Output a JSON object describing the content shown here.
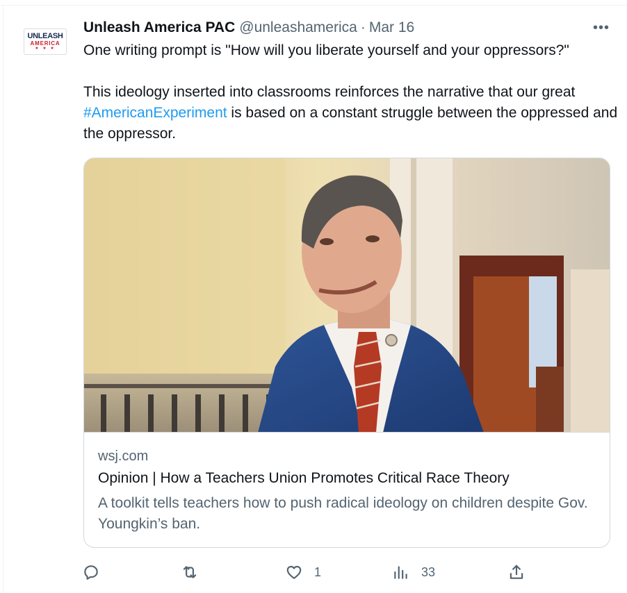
{
  "tweet": {
    "avatar": {
      "line1": "UNLEASH",
      "line2": "AMERICA",
      "stars": "★ ★ ★"
    },
    "author_name": "Unleash America PAC",
    "handle": "@unleashamerica",
    "separator": "·",
    "date": "Mar 16",
    "more_label": "•••",
    "text_para1": "One writing prompt is \"How will you liberate yourself and your oppressors?\"",
    "text_para2_before": "This ideology inserted into classrooms reinforces the narrative that our great ",
    "hashtag": "#AmericanExperiment",
    "text_para2_after": " is based on a constant struggle between the oppressed and the oppressor."
  },
  "card": {
    "domain": "wsj.com",
    "title": "Opinion | How a Teachers Union Promotes Critical Race Theory",
    "description": "A toolkit tells teachers how to push radical ideology on children despite Gov. Youngkin’s ban.",
    "image_icon": "man-in-blue-suit-photo"
  },
  "actions": {
    "reply": {
      "icon": "reply-icon",
      "count": ""
    },
    "retweet": {
      "icon": "retweet-icon",
      "count": ""
    },
    "like": {
      "icon": "heart-icon",
      "count": "1"
    },
    "views": {
      "icon": "views-icon",
      "count": "33"
    },
    "share": {
      "icon": "share-icon",
      "count": ""
    }
  },
  "colors": {
    "text": "#0f1419",
    "secondary": "#536471",
    "link": "#1d9bf0",
    "border": "#cfd9de"
  }
}
